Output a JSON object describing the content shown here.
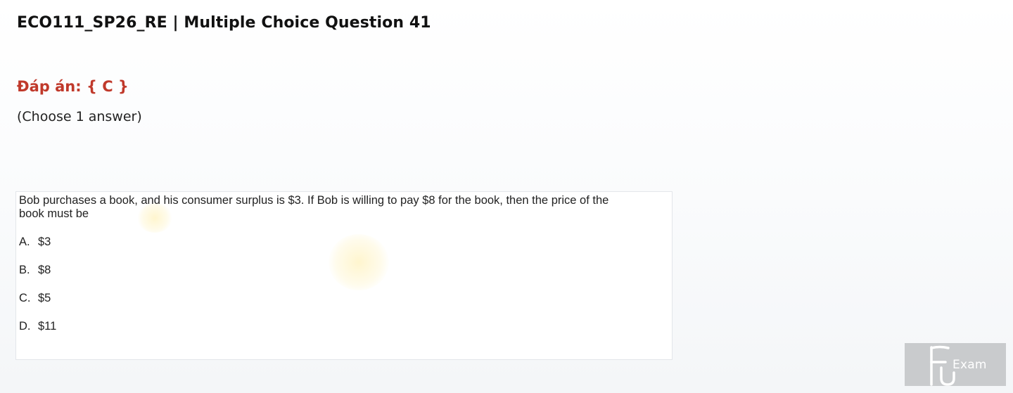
{
  "header": {
    "title": "ECO111_SP26_RE | Multiple Choice Question 41"
  },
  "answer": {
    "text": "Đáp án: { C }"
  },
  "instruction": {
    "text": "(Choose 1 answer)"
  },
  "question": {
    "text": "Bob purchases a book, and his consumer surplus is $3. If Bob is willing to pay $8 for the book, then the price of the book must be",
    "options": [
      {
        "letter": "A.",
        "text": "$3"
      },
      {
        "letter": "B.",
        "text": "$8"
      },
      {
        "letter": "C.",
        "text": "$5"
      },
      {
        "letter": "D.",
        "text": "$11"
      }
    ]
  },
  "logo": {
    "text": "Exam",
    "icon": "fu-exam-logo"
  },
  "colors": {
    "answer": "#c0392b",
    "logo_background": "#c9cbcd"
  }
}
